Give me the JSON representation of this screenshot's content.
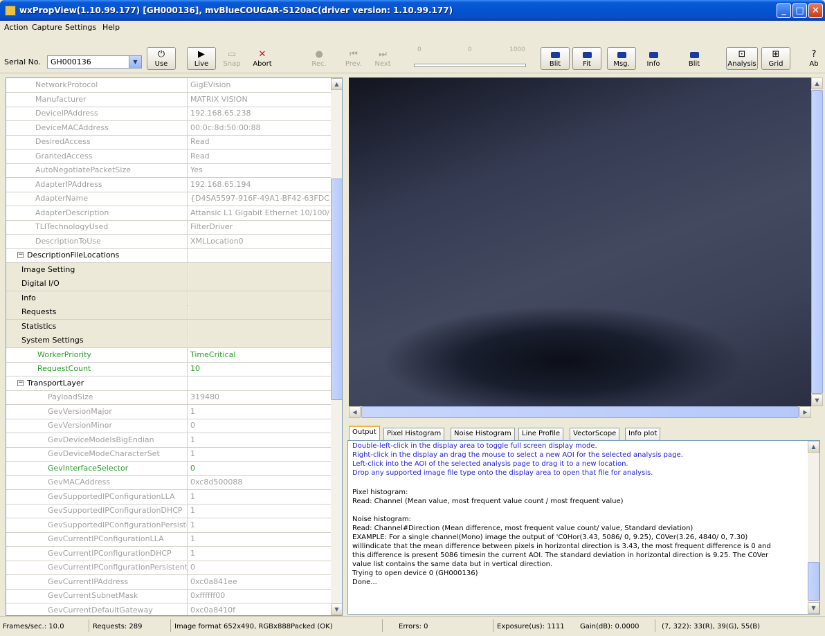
{
  "window": {
    "title": "wxPropView(1.10.99.177) [GH000136], mvBlueCOUGAR-S120aC(driver version: 1.10.99.177)"
  },
  "menu": [
    "Action",
    "Capture",
    "Settings",
    "Help"
  ],
  "toolbar": {
    "serial_label": "Serial No.",
    "serial_value": "GH000136",
    "buttons": {
      "use": "Use",
      "live": "Live",
      "snap": "Snap",
      "abort": "Abort",
      "rec": "Rec.",
      "prev": "Prev.",
      "next": "Next",
      "blit": "Blit",
      "fit": "Fit",
      "msg": "Msg.",
      "info": "Info",
      "blit2": "Blit",
      "analysis": "Analysis",
      "grid": "Grid",
      "about": "Ab"
    },
    "slider_ticks": [
      "0",
      "0",
      "1000"
    ]
  },
  "properties": [
    {
      "name": "NetworkProtocol",
      "value": "GigEVision"
    },
    {
      "name": "Manufacturer",
      "value": "MATRIX VISION"
    },
    {
      "name": "DeviceIPAddress",
      "value": "192.168.65.238"
    },
    {
      "name": "DeviceMACAddress",
      "value": "00:0c:8d:50:00:88"
    },
    {
      "name": "DesiredAccess",
      "value": "Read"
    },
    {
      "name": "GrantedAccess",
      "value": "Read"
    },
    {
      "name": "AutoNegotiatePacketSize",
      "value": "Yes"
    },
    {
      "name": "AdapterIPAddress",
      "value": "192.168.65.194"
    },
    {
      "name": "AdapterName",
      "value": "{D4SA5597-916F-49A1-BF42-63FDC"
    },
    {
      "name": "AdapterDescription",
      "value": "Attansic L1 Gigabit Ethernet 10/100/"
    },
    {
      "name": "TLITechnologyUsed",
      "value": "FilterDriver"
    },
    {
      "name": "DescriptionToUse",
      "value": "XMLLocation0"
    },
    {
      "name": "DescriptionFileLocations",
      "value": ""
    },
    {
      "name": "Image Setting",
      "value": ""
    },
    {
      "name": "Digital I/O",
      "value": ""
    },
    {
      "name": "Info",
      "value": ""
    },
    {
      "name": "Requests",
      "value": ""
    },
    {
      "name": "Statistics",
      "value": ""
    },
    {
      "name": "System Settings",
      "value": ""
    },
    {
      "name": "WorkerPriority",
      "value": "TimeCritical"
    },
    {
      "name": "RequestCount",
      "value": "10"
    },
    {
      "name": "TransportLayer",
      "value": ""
    },
    {
      "name": "PayloadSize",
      "value": "319480"
    },
    {
      "name": "GevVersionMajor",
      "value": "1"
    },
    {
      "name": "GevVersionMinor",
      "value": "0"
    },
    {
      "name": "GevDeviceModeIsBigEndian",
      "value": "1"
    },
    {
      "name": "GevDeviceModeCharacterSet",
      "value": "1"
    },
    {
      "name": "GevInterfaceSelector",
      "value": "0"
    },
    {
      "name": "GevMACAddress",
      "value": "0xc8d500088"
    },
    {
      "name": "GevSupportedIPConfigurationLLA",
      "value": "1"
    },
    {
      "name": "GevSupportedIPConfigurationDHCP",
      "value": "1"
    },
    {
      "name": "GevSupportedIPConfigurationPersiste",
      "value": "1"
    },
    {
      "name": "GevCurrentIPConfigurationLLA",
      "value": "1"
    },
    {
      "name": "GevCurrentIPConfigurationDHCP",
      "value": "1"
    },
    {
      "name": "GevCurrentIPConfigurationPersistent",
      "value": "0"
    },
    {
      "name": "GevCurrentIPAddress",
      "value": "0xc0a841ee"
    },
    {
      "name": "GevCurrentSubnetMask",
      "value": "0xffffff00"
    },
    {
      "name": "GevCurrentDefaultGateway",
      "value": "0xc0a8410f"
    }
  ],
  "tabs": [
    "Output",
    "Pixel Histogram",
    "Noise Histogram",
    "Line Profile",
    "VectorScope",
    "Info plot"
  ],
  "output": [
    "Double-left-click in the display area to toggle full screen display mode.",
    "Right-click in the display an drag the mouse to select a new AOI for the selected analysis page.",
    "Left-click into the AOI of the selected analysis page to drag it to a new location.",
    "Drop any supported image file type onto the display area to open that file for analysis.",
    "",
    "Pixel histogram:",
    "Read: Channel (Mean value, most frequent value count / most frequent value)",
    "",
    "Noise histogram:",
    "Read: Channel#Direction (Mean difference, most frequent value count/  value, Standard deviation)",
    "EXAMPLE: For a single channel(Mono) image the output of 'C0Hor(3.43, 5086/  0, 9.25), C0Ver(3.26, 4840/  0, 7.30)",
    "willindicate that the mean difference between pixels in horizontal direction is 3.43, the most frequent difference is 0 and",
    "this difference is present 5086 timesin the current AOI. The standard deviation in horizontal direction is 9.25. The C0Ver",
    "value list contains the same data but in vertical direction.",
    "Trying to open device 0 (GH000136)",
    "  Done..."
  ],
  "status": {
    "fps": "Frames/sec.: 10.0",
    "requests": "Requests: 289",
    "format": "Image format 652x490, RGBx888Packed (OK)",
    "errors": "Errors: 0",
    "exposure": "Exposure(us): 1111",
    "gain": "Gain(dB): 0.0000",
    "pixel": "(7, 322): 33(R), 39(G), 55(B)"
  }
}
